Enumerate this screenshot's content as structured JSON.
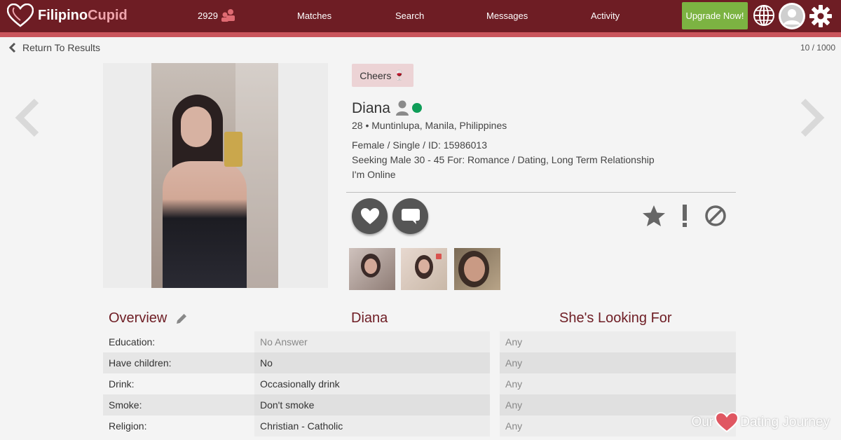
{
  "header": {
    "logo_text_a": "Filipino",
    "logo_text_b": "Cupid",
    "interest_count": "2929",
    "nav": [
      "Matches",
      "Search",
      "Messages",
      "Activity"
    ],
    "upgrade_label": "Upgrade Now!",
    "colors": {
      "bar": "#6e1d24",
      "stripe": "#c9555c",
      "upgrade": "#7cb342"
    }
  },
  "subbar": {
    "back_label": "Return To Results",
    "pager": "10 / 1000"
  },
  "profile": {
    "cheers_label": "Cheers",
    "cheers_emoji": "🍷",
    "name": "Diana",
    "location_line": "28 • Muntinlupa, Manila, Philippines",
    "details_line": "Female / Single / ID: 15986013",
    "seeking_line": "Seeking Male 30 - 45 For: Romance / Dating, Long Term Relationship",
    "status_line": "I'm Online",
    "online_color": "#0f9d58"
  },
  "table": {
    "overview_heading": "Overview",
    "member_heading": "Diana",
    "looking_heading": "She's Looking For",
    "rows": [
      {
        "label": "Education:",
        "member": "No Answer",
        "looking": "Any"
      },
      {
        "label": "Have children:",
        "member": "No",
        "looking": "Any"
      },
      {
        "label": "Drink:",
        "member": "Occasionally drink",
        "looking": "Any"
      },
      {
        "label": "Smoke:",
        "member": "Don't smoke",
        "looking": "Any"
      },
      {
        "label": "Religion:",
        "member": "Christian - Catholic",
        "looking": "Any"
      }
    ]
  },
  "watermark": {
    "left": "Our",
    "right": "Dating Journey"
  }
}
